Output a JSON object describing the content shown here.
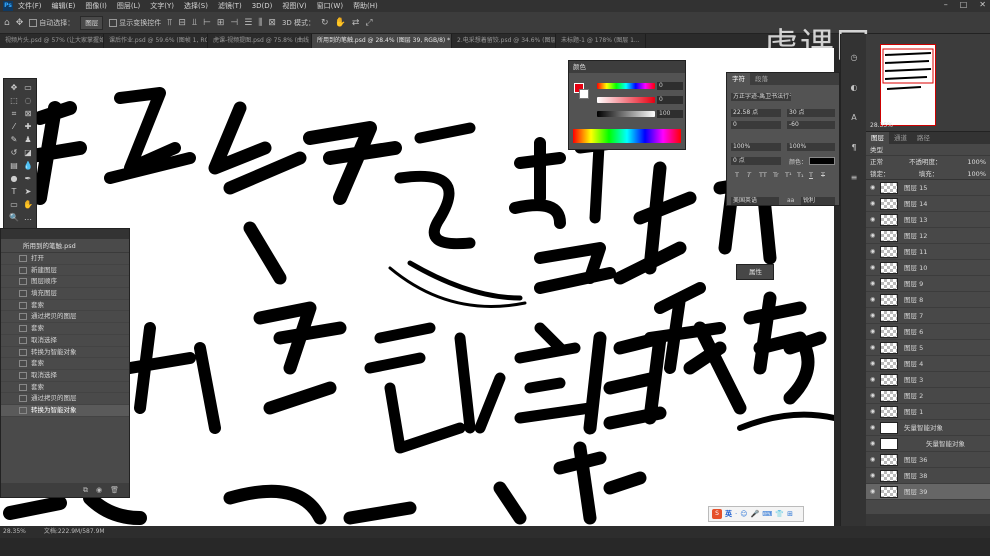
{
  "menubar": {
    "items": [
      "文件(F)",
      "编辑(E)",
      "图像(I)",
      "图层(L)",
      "文字(Y)",
      "选择(S)",
      "滤镜(T)",
      "3D(D)",
      "视图(V)",
      "窗口(W)",
      "帮助(H)"
    ],
    "logo": "Ps"
  },
  "options_bar": {
    "auto_select_label": "自动选择：",
    "layer_dropdown": "图层",
    "show_transform_label": "显示变换控件",
    "mode_3d_label": "3D 模式："
  },
  "tabs": [
    {
      "label": "视频片头.psd @ 57% (让大家掌握如何去..."
    },
    {
      "label": "课后作业.psd @ 59.6% (图帧 1, RGB/8..."
    },
    {
      "label": "虎课-视频提图.psd @ 75.8% (曲线 1, 图层..."
    },
    {
      "label": "所用到的笔触.psd @ 28.4% (图层 39, RGB/8) *",
      "active": true
    },
    {
      "label": "2.电采想着留饺.psd @ 34.6% (图层 6, RGB..."
    },
    {
      "label": "未标题-1 @ 178% (图层 1..."
    }
  ],
  "watermark": "虎课网",
  "history": {
    "file": "所用到的笔触.psd",
    "items": [
      "打开",
      "新建图层",
      "图层顺序",
      "填充图层",
      "套索",
      "通过拷贝的图层",
      "套索",
      "取消选择",
      "转换为智能对象",
      "套索",
      "取消选择",
      "套索",
      "通过拷贝的图层",
      "转换为智能对象"
    ],
    "selected_index": 13
  },
  "color_panel": {
    "title": "颜色",
    "values": [
      "0",
      "0",
      "100"
    ],
    "units": [
      "%",
      "%",
      "%"
    ],
    "fg": "#e60012",
    "bg": "#ffffff"
  },
  "char_panel": {
    "tabs": [
      "字符",
      "段落"
    ],
    "font_family": "方正字迹-禹卫书法行书简体",
    "font_size": "22.58 点",
    "leading": "30 点",
    "kerning": "0",
    "tracking": "-60",
    "vscale": "100%",
    "hscale": "100%",
    "baseline": "0 点",
    "color_label": "颜色：",
    "type_styles": [
      "T",
      "T",
      "TT",
      "Tr",
      "T¹",
      "T₁",
      "T",
      "T"
    ],
    "language": "美国英语",
    "aa": "锐利",
    "aa_prefix": "aa"
  },
  "properties_badge": "属性",
  "navigator": {
    "zoom": "28.35%"
  },
  "layers_panel": {
    "tabs": [
      "图层",
      "通道",
      "路径"
    ],
    "filter": "类型",
    "blend_mode": "正常",
    "opacity_label": "不透明度：",
    "opacity": "100%",
    "lock_label": "锁定：",
    "fill_label": "填充：",
    "fill": "100%",
    "layers": [
      "图层 15",
      "图层 14",
      "图层 13",
      "图层 12",
      "图层 11",
      "图层 10",
      "图层 9",
      "图层 8",
      "图层 7",
      "图层 6",
      "图层 5",
      "图层 4",
      "图层 3",
      "图层 2",
      "图层 1",
      "矢量智能对象",
      "矢量智能对象",
      "图层 36",
      "图层 38",
      "图层 39"
    ],
    "selected_index": 19
  },
  "status": {
    "zoom": "28.35%",
    "doc": "文档:222.9M/587.9M"
  },
  "ime": {
    "lang": "英",
    "icons": [
      "·",
      "☺",
      "🎤",
      "⌨",
      "👕",
      "⊞"
    ]
  }
}
